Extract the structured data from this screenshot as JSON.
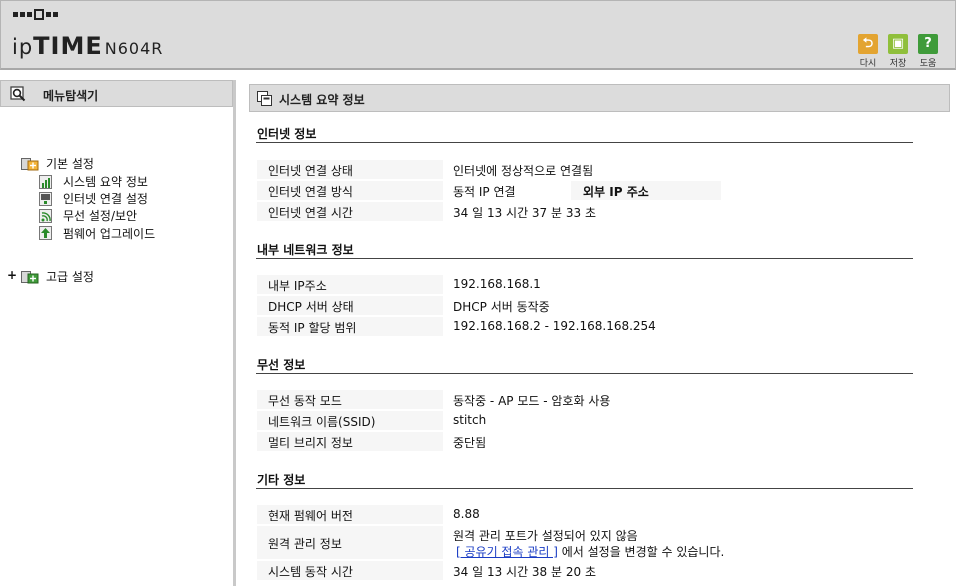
{
  "header": {
    "brand_prefix": "ip",
    "brand_main": "TIME",
    "brand_model": "N604R",
    "buttons": [
      {
        "label": "다시",
        "icon": "undo-icon",
        "color": "#e3a431"
      },
      {
        "label": "저장",
        "icon": "save-icon",
        "color": "#8fbf3b"
      },
      {
        "label": "도움",
        "icon": "help-icon",
        "color": "#3f9b3a"
      }
    ]
  },
  "left": {
    "title": "메뉴탐색기",
    "groups": [
      {
        "label": "기본 설정",
        "expanded": true,
        "items": [
          "시스템 요약 정보",
          "인터넷 연결 설정",
          "무선 설정/보안",
          "펌웨어 업그레이드"
        ]
      },
      {
        "label": "고급 설정",
        "expanded": false,
        "toggle": "+"
      }
    ]
  },
  "main": {
    "title": "시스템 요약 정보",
    "sections": [
      {
        "title": "인터넷 정보",
        "rows": [
          {
            "key": "인터넷 연결 상태",
            "value": "인터넷에 정상적으로 연결됨"
          },
          {
            "key": "인터넷 연결 방식",
            "value": "동적 IP 연결",
            "extra_key": "외부 IP 주소"
          },
          {
            "key": "인터넷 연결 시간",
            "value": "34 일 13 시간 37 분 33 초"
          }
        ]
      },
      {
        "title": "내부 네트워크 정보",
        "rows": [
          {
            "key": "내부 IP주소",
            "value": "192.168.168.1"
          },
          {
            "key": "DHCP 서버 상태",
            "value": "DHCP 서버 동작중"
          },
          {
            "key": "동적 IP 할당 범위",
            "value": "192.168.168.2 -  192.168.168.254"
          }
        ]
      },
      {
        "title": "무선 정보",
        "rows": [
          {
            "key": "무선 동작 모드",
            "value": "동작중 - AP 모드 - 암호화 사용"
          },
          {
            "key": "네트워크 이름(SSID)",
            "value": "stitch"
          },
          {
            "key": "멀티 브리지 정보",
            "value": "중단됨"
          }
        ]
      },
      {
        "title": "기타 정보",
        "rows": [
          {
            "key": "현재 펌웨어 버전",
            "value": "8.88"
          },
          {
            "key": "원격 관리 정보",
            "value": "원격 관리 포트가 설정되어 있지 않음",
            "link": "[ 공유기 접속 관리 ]",
            "link_suffix": " 에서 설정을 변경할 수 있습니다."
          },
          {
            "key": "시스템 동작 시간",
            "value": "34 일 13 시간 38 분 20 초"
          }
        ]
      }
    ]
  }
}
